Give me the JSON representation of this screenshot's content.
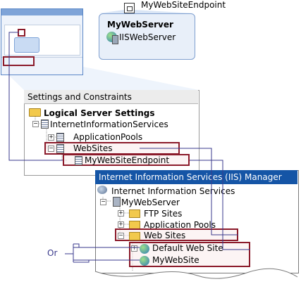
{
  "endpoint_label": "MyWebSiteEndpoint",
  "server_card": {
    "title": "MyWebServer",
    "subtitle": "IISWebServer"
  },
  "settings": {
    "header": "Settings and Constraints",
    "root": "Logical Server Settings",
    "items": [
      "InternetInformationServices",
      "ApplicationPools",
      "WebSites",
      "MyWebSiteEndpoint"
    ]
  },
  "iis": {
    "header": "Internet Information Services (IIS) Manager",
    "root": "Internet Information Services",
    "items": [
      "MyWebServer",
      "FTP Sites",
      "Application Pools",
      "Web Sites",
      "Default Web Site",
      "MyWebSite"
    ]
  },
  "or_label": "Or",
  "colors": {
    "highlight_border": "#8b1a2a",
    "highlight_fill": "#faecec",
    "connector": "#3a3a8c",
    "iis_header": "#1555a6",
    "card_fill": "#e8eff9"
  },
  "icons": [
    "endpoint-icon",
    "globe-server-icon",
    "folder-icon",
    "list-icon",
    "computer-icon",
    "globe-icon",
    "plus-icon",
    "minus-icon"
  ]
}
